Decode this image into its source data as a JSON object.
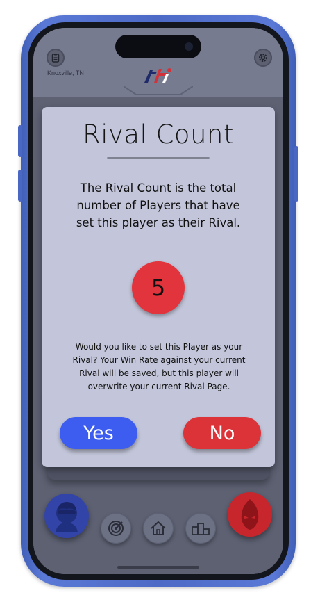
{
  "header": {
    "location": "Knoxville, TN",
    "left_icon": "clipboard-icon",
    "right_icon": "gear-icon",
    "logo_icon": "app-logo"
  },
  "modal": {
    "title": "Rival Count",
    "description": "The Rival Count is the total number of Players that have set this player as their Rival.",
    "count": "5",
    "question": "Would you like to set this Player as your Rival? Your Win Rate against your current Rival will be saved, but this player will overwrite your current Rival Page.",
    "yes_label": "Yes",
    "no_label": "No"
  },
  "nav": {
    "items": [
      {
        "icon": "player-avatar-icon"
      },
      {
        "icon": "target-icon"
      },
      {
        "icon": "home-icon"
      },
      {
        "icon": "podium-icon"
      },
      {
        "icon": "rival-avatar-icon"
      }
    ]
  },
  "colors": {
    "phone_frame": "#4d6ac6",
    "card_bg": "#c3c6da",
    "accent_blue": "#3d5df0",
    "accent_red": "#dc3339"
  }
}
